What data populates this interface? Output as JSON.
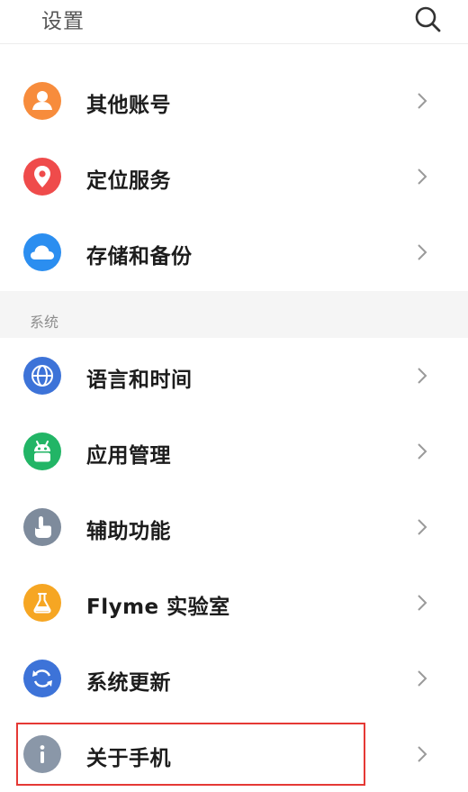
{
  "header": {
    "title": "设置"
  },
  "top_items": [
    {
      "label": "其他账号",
      "icon": "account-icon",
      "color": "#f78c3c"
    },
    {
      "label": "定位服务",
      "icon": "location-pin-icon",
      "color": "#ef4b4b"
    },
    {
      "label": "存储和备份",
      "icon": "cloud-icon",
      "color": "#2b8ef0"
    }
  ],
  "section": {
    "label": "系统"
  },
  "system_items": [
    {
      "label": "语言和时间",
      "icon": "globe-icon",
      "color": "#3d73d8"
    },
    {
      "label": "应用管理",
      "icon": "android-icon",
      "color": "#22b566"
    },
    {
      "label": "辅助功能",
      "icon": "hand-pointer-icon",
      "color": "#7e8b9c"
    },
    {
      "label": "Flyme 实验室",
      "icon": "flask-icon",
      "color": "#f6a623"
    },
    {
      "label": "系统更新",
      "icon": "refresh-icon",
      "color": "#3d73d8"
    },
    {
      "label": "关于手机",
      "icon": "info-icon",
      "color": "#8a97a8"
    }
  ],
  "highlight_color": "#e53935"
}
